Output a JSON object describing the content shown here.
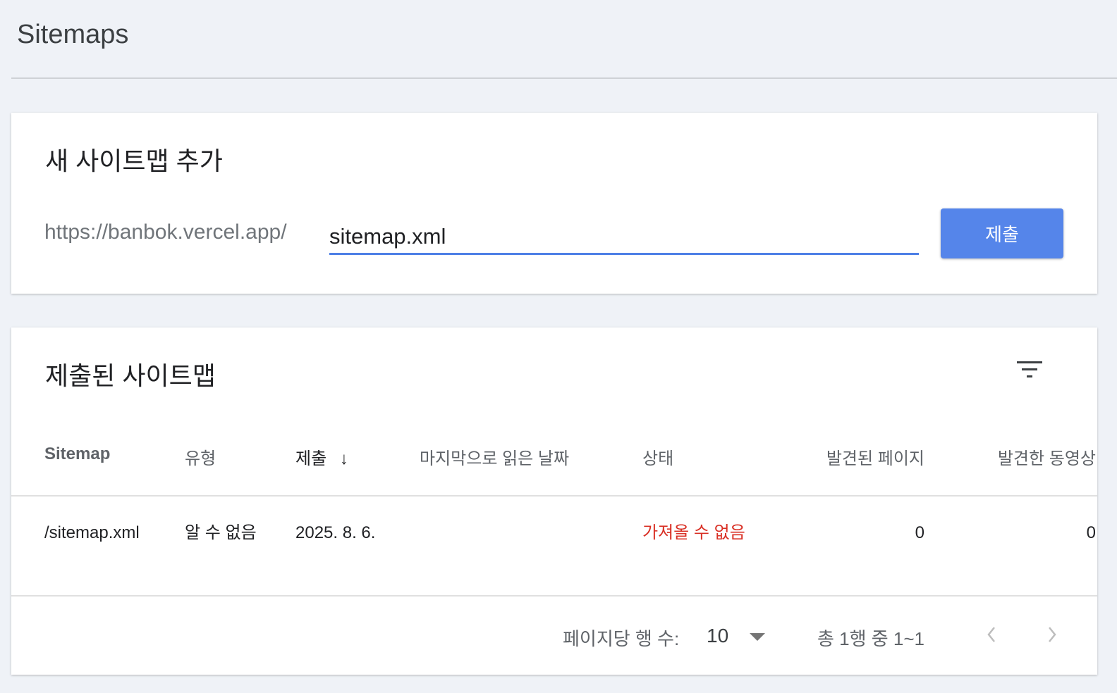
{
  "page": {
    "title": "Sitemaps"
  },
  "add": {
    "title": "새 사이트맵 추가",
    "prefix": "https://banbok.vercel.app/",
    "value": "sitemap.xml",
    "submit": "제출"
  },
  "submitted": {
    "title": "제출된 사이트맵",
    "columns": [
      "Sitemap",
      "유형",
      "제출",
      "마지막으로 읽은 날짜",
      "상태",
      "발견된 페이지",
      "발견한 동영상"
    ],
    "rows": [
      {
        "sitemap": "/sitemap.xml",
        "type": "알 수 없음",
        "submitted": "2025. 8. 6.",
        "last_read": "",
        "status": "가져올 수 없음",
        "pages": "0",
        "videos": "0"
      }
    ],
    "footer": {
      "rows_label": "페이지당 행 수:",
      "rows_value": "10",
      "range": "총 1행 중 1~1"
    }
  },
  "colors": {
    "accent": "#5585ea",
    "error": "#d93025"
  }
}
